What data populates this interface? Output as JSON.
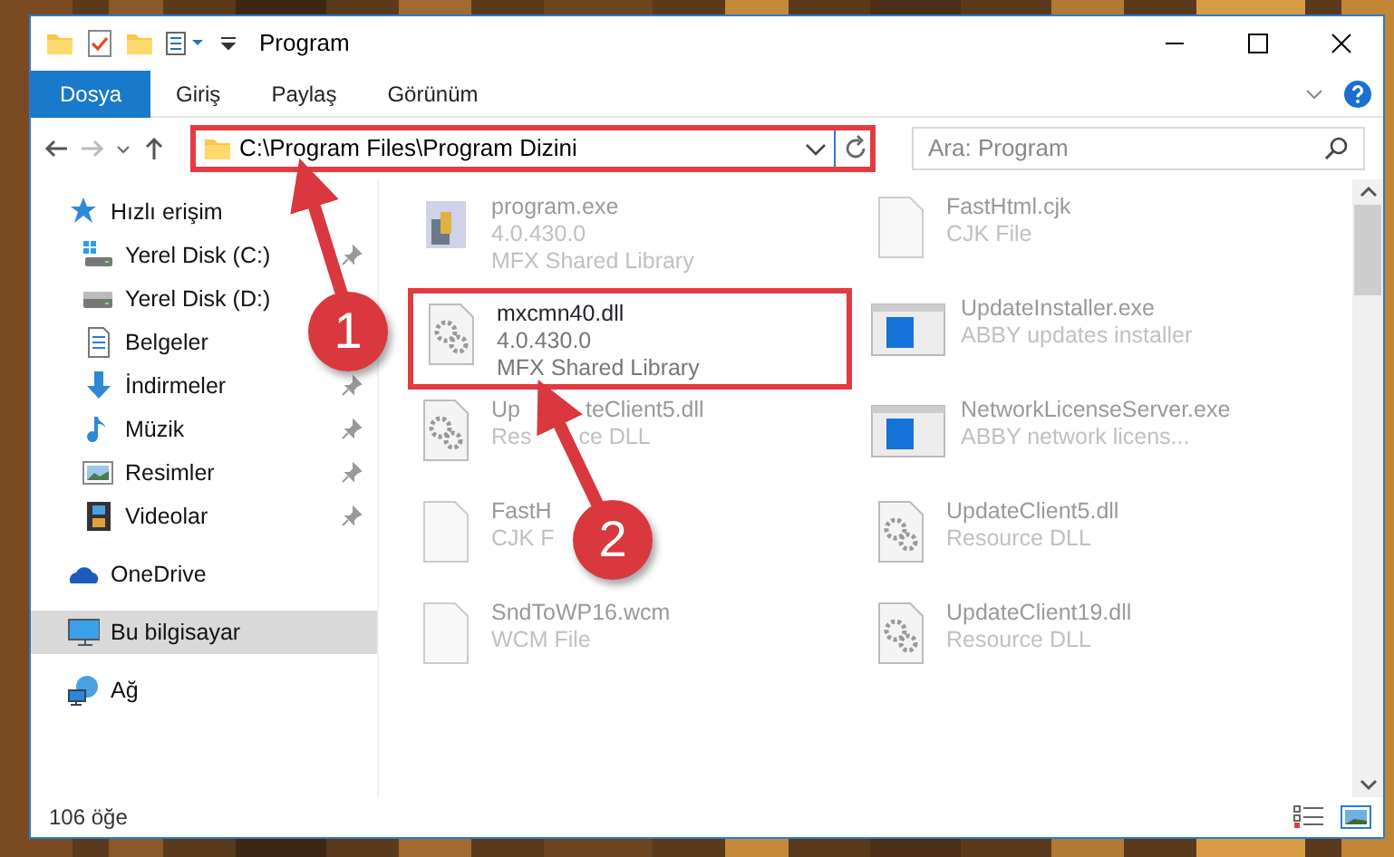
{
  "window": {
    "title": "Program"
  },
  "ribbon_tabs": [
    {
      "label": "Dosya",
      "selected": true
    },
    {
      "label": "Giriş",
      "selected": false
    },
    {
      "label": "Paylaş",
      "selected": false
    },
    {
      "label": "Görünüm",
      "selected": false
    }
  ],
  "address_bar": {
    "value": "C:\\Program Files\\Program Dizini",
    "highlighted": true
  },
  "search": {
    "placeholder": "Ara: Program"
  },
  "sidebar": {
    "items": [
      {
        "label": "Hızlı erişim",
        "selected": false,
        "children": [
          {
            "label": "Yerel Disk (C:)",
            "pinned": true,
            "selected": false
          },
          {
            "label": "Yerel Disk (D:)",
            "pinned": false,
            "selected": false
          },
          {
            "label": "Belgeler",
            "pinned": false,
            "selected": false
          },
          {
            "label": "İndirmeler",
            "pinned": true,
            "selected": false
          },
          {
            "label": "Müzik",
            "pinned": true,
            "selected": false
          },
          {
            "label": "Resimler",
            "pinned": true,
            "selected": false
          },
          {
            "label": "Videolar",
            "pinned": true,
            "selected": false
          }
        ]
      },
      {
        "label": "OneDrive",
        "selected": false
      },
      {
        "label": "Bu bilgisayar",
        "selected": true
      },
      {
        "label": "Ağ",
        "selected": false
      }
    ]
  },
  "files": [
    {
      "name": "program.exe",
      "details": [
        "4.0.430.0",
        "MFX Shared Library"
      ],
      "kind": "program",
      "dimmed": true,
      "highlighted": false
    },
    {
      "name": "FastHtml.cjk",
      "details": [
        "CJK File"
      ],
      "kind": "blank",
      "dimmed": true,
      "highlighted": false
    },
    {
      "name": "mxcmn40.dll",
      "details": [
        "4.0.430.0",
        "MFX Shared Library"
      ],
      "kind": "gears",
      "dimmed": false,
      "highlighted": true
    },
    {
      "name": "UpdateInstaller.exe",
      "details": [
        "ABBY updates installer"
      ],
      "kind": "app",
      "dimmed": true,
      "highlighted": false
    },
    {
      "name": [
        "Up",
        "teClient5.dll"
      ],
      "details": [
        [
          "Res",
          "ce DLL"
        ]
      ],
      "kind": "gears",
      "dimmed": true,
      "highlighted": false
    },
    {
      "name": "NetworkLicenseServer.exe",
      "details": [
        "ABBY network licens..."
      ],
      "kind": "app",
      "dimmed": true,
      "highlighted": false
    },
    {
      "name": "FastH",
      "details": [
        "CJK F"
      ],
      "kind": "blank",
      "dimmed": true,
      "highlighted": false
    },
    {
      "name": "UpdateClient5.dll",
      "details": [
        "Resource DLL"
      ],
      "kind": "gears",
      "dimmed": true,
      "highlighted": false
    },
    {
      "name": "SndToWP16.wcm",
      "details": [
        "WCM File"
      ],
      "kind": "blank",
      "dimmed": true,
      "highlighted": false
    },
    {
      "name": "UpdateClient19.dll",
      "details": [
        "Resource DLL"
      ],
      "kind": "gears",
      "dimmed": true,
      "highlighted": false
    }
  ],
  "status_bar": {
    "count": "106 öğe"
  },
  "annotations": [
    {
      "number": "1"
    },
    {
      "number": "2"
    }
  ]
}
